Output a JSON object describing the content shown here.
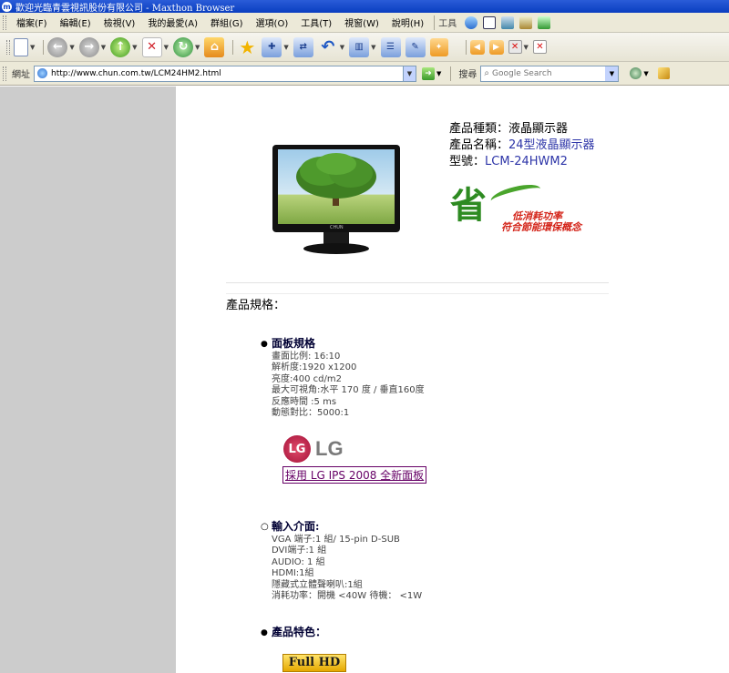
{
  "window": {
    "title": "歡迎光臨青雲視訊股份有限公司 - Maxthon Browser"
  },
  "menu": {
    "items": [
      "檔案(F)",
      "編輯(E)",
      "檢視(V)",
      "我的最愛(A)",
      "群組(G)",
      "選項(O)",
      "工具(T)",
      "視窗(W)",
      "說明(H)"
    ],
    "tools_label": "工具"
  },
  "address": {
    "label": "網址",
    "url": "http://www.chun.com.tw/LCM24HM2.html",
    "search_label": "搜尋",
    "search_placeholder": "Google Search"
  },
  "product": {
    "monitor_brand": "CHUN",
    "category_label": "產品種類：",
    "category_value": "液晶顯示器",
    "name_label": "產品名稱：",
    "name_value": "24型液晶顯示器",
    "model_label": "型號：",
    "model_value": "LCM-24HWM2"
  },
  "eco": {
    "char": "省",
    "line1": "低消耗功率",
    "line2": "符合節能環保概念"
  },
  "specs": {
    "section_title": "產品規格：",
    "panel": {
      "title": "面板規格",
      "lines": [
        "畫面比例: 16:10",
        "解析度:1920 x1200",
        "亮度:400 cd/m2",
        "最大可視角:水平 170 度 / 垂直160度",
        "反應時間 :5 ms",
        "動態對比：5000:1"
      ]
    },
    "lg": {
      "logo_text": "LG",
      "circle_text": "LG",
      "link_text": "採用 LG IPS 2008 全新面板"
    },
    "io": {
      "title": "輸入介面:",
      "lines": [
        "VGA 端子:1 組/ 15-pin D-SUB",
        "DVI端子:1 組",
        "AUDIO: 1 組",
        "HDMI:1組",
        "隱藏式立體聲喇叭:1組",
        "消耗功率：開機 <40W 待機： <1W"
      ]
    },
    "features": {
      "title": "產品特色：",
      "badge": "Full HD"
    }
  }
}
